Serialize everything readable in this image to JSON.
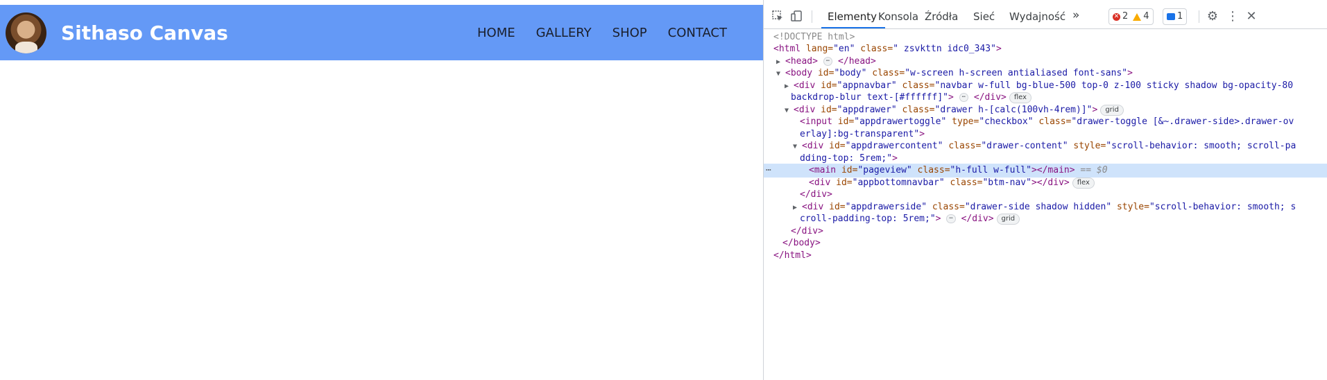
{
  "site": {
    "brand": "Sithaso Canvas",
    "nav": [
      "HOME",
      "GALLERY",
      "SHOP",
      "CONTACT"
    ],
    "colors": {
      "navbar": "#6499f6",
      "brand_text": "#ffffff"
    }
  },
  "devtools": {
    "tabs": [
      "Elementy",
      "Konsola",
      "Źródła",
      "Sieć",
      "Wydajność"
    ],
    "active_tab": "Elementy",
    "more_tabs": "»",
    "badges": {
      "errors": "2",
      "warnings": "4",
      "messages": "1"
    },
    "icons": [
      "inspect-icon",
      "device-toggle-icon",
      "settings-icon",
      "more-vert-icon",
      "close-icon"
    ],
    "code_lines": {
      "l1": "<!DOCTYPE html>",
      "l2a": "<html ",
      "l2b": "lang=",
      "l2c": "\"en\"",
      "l2d": " class=",
      "l2e": "\" zsvkttn idc0_343\"",
      "l2f": ">",
      "l3a": "<head>",
      "l3b": "</head>",
      "l4a": "<body ",
      "l4b": "id=",
      "l4c": "\"body\"",
      "l4d": " class=",
      "l4e": "\"w-screen h-screen antialiased font-sans\"",
      "l4f": ">",
      "l5a": "<div ",
      "l5b": "id=",
      "l5c": "\"appnavbar\"",
      "l5d": " class=",
      "l5e": "\"navbar w-full bg-blue-500 top-0 z-100 sticky shadow bg-opacity-80",
      "l6a": "backdrop-blur text-[#ffffff]\"",
      "l6b": ">",
      "l6c": "</div>",
      "l6pill": "flex",
      "l7a": "<div ",
      "l7b": "id=",
      "l7c": "\"appdrawer\"",
      "l7d": " class=",
      "l7e": "\"drawer h-[calc(100vh-4rem)]\"",
      "l7f": ">",
      "l7pill": "grid",
      "l8a": "<input ",
      "l8b": "id=",
      "l8c": "\"appdrawertoggle\"",
      "l8d": " type=",
      "l8e": "\"checkbox\"",
      "l8f": " class=",
      "l8g": "\"drawer-toggle [&~.drawer-side>.drawer-ov",
      "l9a": "erlay]:bg-transparent\"",
      "l9b": ">",
      "l10a": "<div ",
      "l10b": "id=",
      "l10c": "\"appdrawercontent\"",
      "l10d": " class=",
      "l10e": "\"drawer-content\"",
      "l10f": " style=",
      "l10g": "\"scroll-behavior: smooth; scroll-pa",
      "l11a": "dding-top: 5rem;\"",
      "l11b": ">",
      "l12a": "<main ",
      "l12b": "id=",
      "l12c": "\"pageview\"",
      "l12d": " class=",
      "l12e": "\"h-full w-full\"",
      "l12f": "></main>",
      "l12g": " == $0",
      "l13a": "<div ",
      "l13b": "id=",
      "l13c": "\"appbottomnavbar\"",
      "l13d": " class=",
      "l13e": "\"btm-nav\"",
      "l13f": "></div>",
      "l13pill": "flex",
      "l14": "</div>",
      "l15a": "<div ",
      "l15b": "id=",
      "l15c": "\"appdrawerside\"",
      "l15d": " class=",
      "l15e": "\"drawer-side shadow hidden\"",
      "l15f": " style=",
      "l15g": "\"scroll-behavior: smooth; s",
      "l16a": "croll-padding-top: 5rem;\"",
      "l16b": ">",
      "l16c": "</div>",
      "l16pill": "grid",
      "l17": "</div>",
      "l18": "</body>",
      "l19": "</html>",
      "ellipsis": "⋯",
      "gutter_dots": "⋯"
    }
  }
}
